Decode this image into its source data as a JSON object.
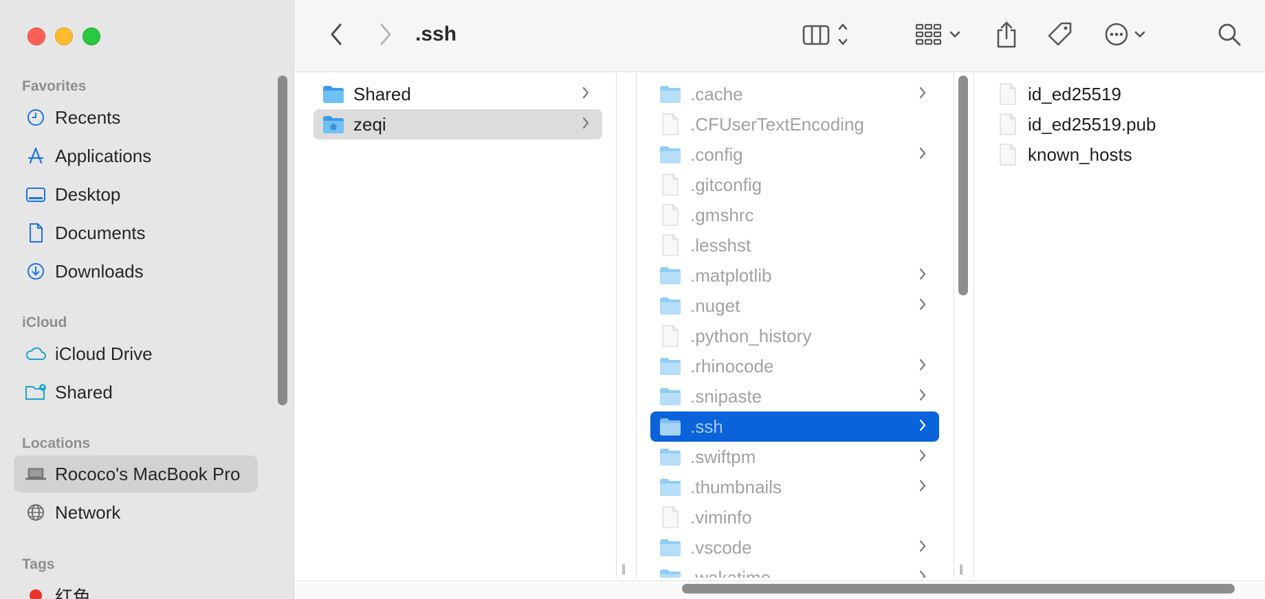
{
  "window": {
    "title": ".ssh"
  },
  "colors": {
    "accent": "#0b63dc",
    "folder": "#5db4f0",
    "hidden_text": "#a2a2a2"
  },
  "sidebar": {
    "sections": [
      {
        "label": "Favorites"
      },
      {
        "label": "iCloud"
      },
      {
        "label": "Locations"
      },
      {
        "label": "Tags"
      }
    ],
    "favorites": [
      {
        "label": "Recents",
        "icon": "clock-icon"
      },
      {
        "label": "Applications",
        "icon": "applications-icon"
      },
      {
        "label": "Desktop",
        "icon": "desktop-icon"
      },
      {
        "label": "Documents",
        "icon": "document-icon"
      },
      {
        "label": "Downloads",
        "icon": "downloads-icon"
      }
    ],
    "icloud": [
      {
        "label": "iCloud Drive",
        "icon": "cloud-icon"
      },
      {
        "label": "Shared",
        "icon": "shared-folder-icon"
      }
    ],
    "locations": [
      {
        "label": "Rococo's MacBook Pro",
        "icon": "laptop-icon",
        "selected": true
      },
      {
        "label": "Network",
        "icon": "globe-icon"
      }
    ],
    "tags": [
      {
        "label": "红色",
        "color": "#e8352d"
      }
    ]
  },
  "toolbar": {
    "back": "chevron-left-icon",
    "forward": "chevron-right-icon",
    "view": "column-view-icon",
    "group": "group-icon",
    "share": "share-icon",
    "tag": "tag-icon",
    "more": "more-icon",
    "search": "search-icon"
  },
  "columns": {
    "col1": [
      {
        "name": "Shared",
        "type": "folder"
      },
      {
        "name": "zeqi",
        "type": "home-folder",
        "selected": true
      }
    ],
    "col2": [
      {
        "name": ".cache",
        "type": "folder"
      },
      {
        "name": ".CFUserTextEncoding",
        "type": "file"
      },
      {
        "name": ".config",
        "type": "folder"
      },
      {
        "name": ".gitconfig",
        "type": "file"
      },
      {
        "name": ".gmshrc",
        "type": "file"
      },
      {
        "name": ".lesshst",
        "type": "file"
      },
      {
        "name": ".matplotlib",
        "type": "folder"
      },
      {
        "name": ".nuget",
        "type": "folder"
      },
      {
        "name": ".python_history",
        "type": "file"
      },
      {
        "name": ".rhinocode",
        "type": "folder"
      },
      {
        "name": ".snipaste",
        "type": "folder"
      },
      {
        "name": ".ssh",
        "type": "folder",
        "selected": true
      },
      {
        "name": ".swiftpm",
        "type": "folder"
      },
      {
        "name": ".thumbnails",
        "type": "folder"
      },
      {
        "name": ".viminfo",
        "type": "file"
      },
      {
        "name": ".vscode",
        "type": "folder"
      },
      {
        "name": ".wakatime",
        "type": "folder"
      }
    ],
    "col3": [
      {
        "name": "id_ed25519",
        "type": "file"
      },
      {
        "name": "id_ed25519.pub",
        "type": "file"
      },
      {
        "name": "known_hosts",
        "type": "file"
      }
    ]
  }
}
